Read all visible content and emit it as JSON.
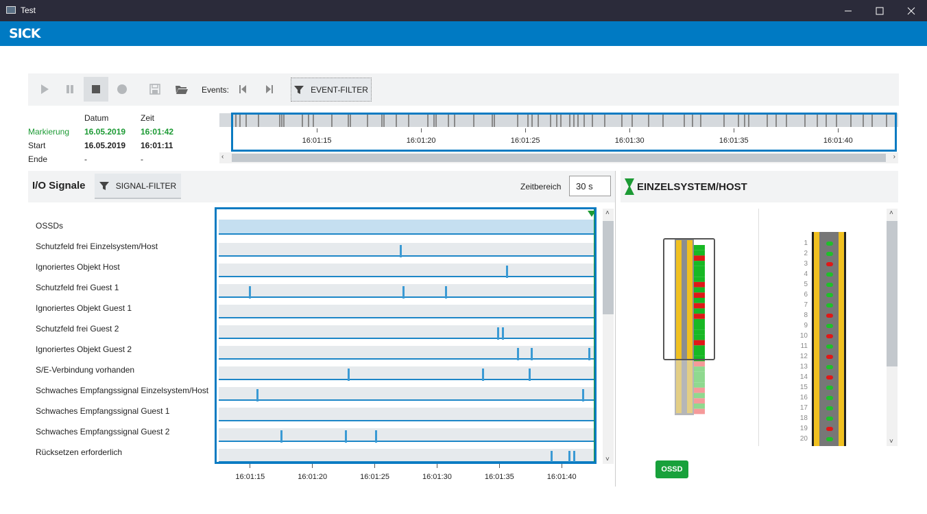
{
  "window": {
    "title": "Test"
  },
  "brand": {
    "logo": "SICK",
    "color": "#007ac3"
  },
  "toolbar": {
    "events_label": "Events:",
    "event_filter_label": "EVENT-FILTER",
    "buttons": [
      "play-icon",
      "pause-icon",
      "stop-icon",
      "record-icon",
      "save-icon",
      "open-folder-icon",
      "event-previous-icon",
      "event-next-icon",
      "filter-icon"
    ]
  },
  "time_info": {
    "col_datum": "Datum",
    "col_zeit": "Zeit",
    "rows": [
      {
        "label": "Markierung",
        "datum": "16.05.2019",
        "zeit": "16:01:42"
      },
      {
        "label": "Start",
        "datum": "16.05.2019",
        "zeit": "16:01:11"
      },
      {
        "label": "Ende",
        "datum": "-",
        "zeit": "-"
      }
    ]
  },
  "overview": {
    "ticks": [
      "16:01:15",
      "16:01:20",
      "16:01:25",
      "16:01:30",
      "16:01:35",
      "16:01:40"
    ],
    "tick_seconds": [
      15,
      20,
      25,
      30,
      35,
      40
    ],
    "range_seconds": [
      11,
      42.7
    ],
    "events": [
      11.1,
      11.3,
      11.6,
      12.2,
      13.2,
      13.3,
      13.4,
      14.3,
      14.6,
      14.8,
      15.7,
      16.5,
      16.6,
      17.4,
      18.1,
      18.2,
      18.8,
      19.4,
      20.3,
      20.6,
      20.7,
      21.3,
      21.6,
      22.5,
      23.4,
      23.5,
      24.6,
      25.1,
      25.3,
      25.6,
      26.2,
      26.5,
      26.7,
      27.1,
      27.3,
      27.5,
      27.8,
      28.2,
      28.8,
      29.6,
      30.1,
      30.9,
      31.6,
      32.6,
      33.0,
      33.4,
      34.5,
      35.2,
      35.5,
      35.7,
      36.6,
      37.0,
      37.5,
      38.4,
      39.0,
      39.4,
      39.9,
      40.6,
      41.2,
      41.6,
      42.3
    ]
  },
  "io": {
    "title": "I/O Signale",
    "signal_filter_label": "SIGNAL-FILTER",
    "zeitbereich_label": "Zeitbereich",
    "zeitbereich_value": "30 s",
    "axis_ticks": [
      "16:01:15",
      "16:01:20",
      "16:01:25",
      "16:01:30",
      "16:01:35",
      "16:01:40"
    ],
    "axis_seconds": [
      15,
      20,
      25,
      30,
      35,
      40
    ],
    "range_seconds": [
      12.5,
      42.6
    ],
    "signals": [
      {
        "name": "OSSDs",
        "high": true,
        "events": []
      },
      {
        "name": "Schutzfeld frei Einzelsystem/Host",
        "events": [
          27.1
        ]
      },
      {
        "name": "Ignoriertes Objekt Host",
        "events": [
          35.6
        ]
      },
      {
        "name": "Schutzfeld frei Guest 1",
        "events": [
          15.0,
          27.3,
          30.7
        ]
      },
      {
        "name": "Ignoriertes Objekt Guest 1",
        "events": []
      },
      {
        "name": "Schutzfeld frei Guest 2",
        "events": [
          34.9,
          35.3
        ]
      },
      {
        "name": "Ignoriertes Objekt Guest 2",
        "events": [
          36.5,
          37.6,
          42.2
        ]
      },
      {
        "name": "S/E-Verbindung vorhanden",
        "events": [
          22.9,
          33.7,
          37.4
        ]
      },
      {
        "name": "Schwaches Empfangssignal Einzelsystem/Host",
        "events": [
          15.6,
          41.7
        ]
      },
      {
        "name": "Schwaches Empfangssignal Guest 1",
        "events": []
      },
      {
        "name": "Schwaches Empfangssignal Guest 2",
        "events": [
          17.5,
          22.7,
          25.1
        ]
      },
      {
        "name": "Rücksetzen erforderlich",
        "events": [
          39.2,
          40.6,
          41.0
        ]
      }
    ]
  },
  "host": {
    "title": "EINZELSYSTEM/HOST",
    "ossd_label": "OSSD",
    "ossd_color": "#18a13b",
    "beam_numbers": [
      "1",
      "2",
      "3",
      "4",
      "5",
      "6",
      "7",
      "8",
      "9",
      "10",
      "11",
      "12",
      "13",
      "14",
      "15",
      "16",
      "17",
      "18",
      "19",
      "20"
    ],
    "beam_states": [
      "green",
      "green",
      "red",
      "green",
      "green",
      "green",
      "green",
      "red",
      "green",
      "red",
      "green",
      "red",
      "green",
      "red",
      "green",
      "green",
      "green",
      "green",
      "red",
      "green"
    ]
  }
}
